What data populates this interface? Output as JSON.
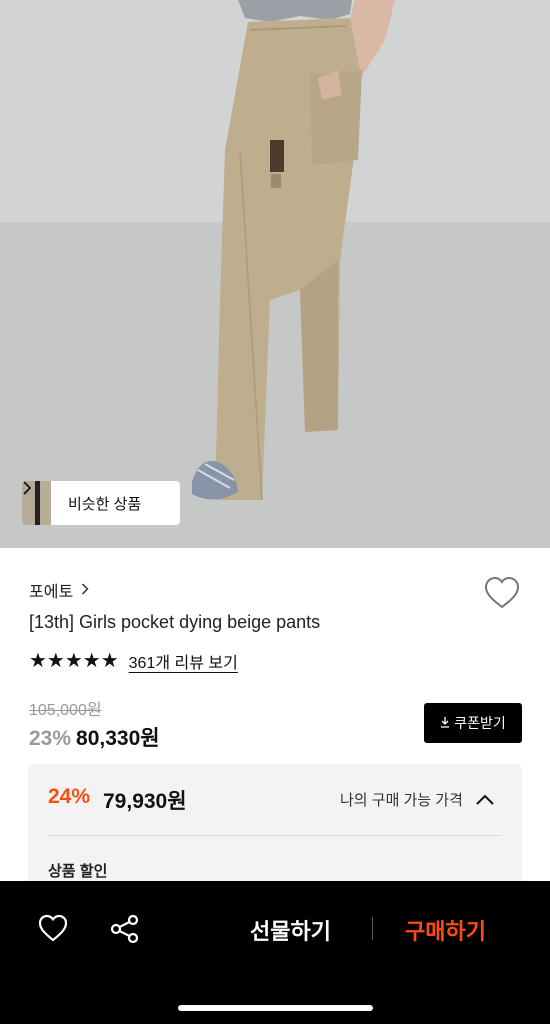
{
  "similar": {
    "label": "비슷한 상품"
  },
  "product": {
    "brand": "포에토",
    "title": "[13th] Girls pocket dying beige pants",
    "rating_stars": "★★★★★",
    "review_link": "361개 리뷰 보기",
    "original_price": "105,000원",
    "discount_rate": "23%",
    "sale_price": "80,330원"
  },
  "coupon": {
    "label": "쿠폰받기",
    "icon": "download-icon"
  },
  "my_price": {
    "discount_rate": "24%",
    "price": "79,930원",
    "label": "나의 구매 가능 가격",
    "section_label": "상품 할인"
  },
  "bottom": {
    "gift_label": "선물하기",
    "buy_label": "구매하기",
    "heart_icon": "heart-outline-icon",
    "share_icon": "share-icon"
  },
  "colors": {
    "accent": "#ff4b11",
    "bar": "#000000"
  }
}
